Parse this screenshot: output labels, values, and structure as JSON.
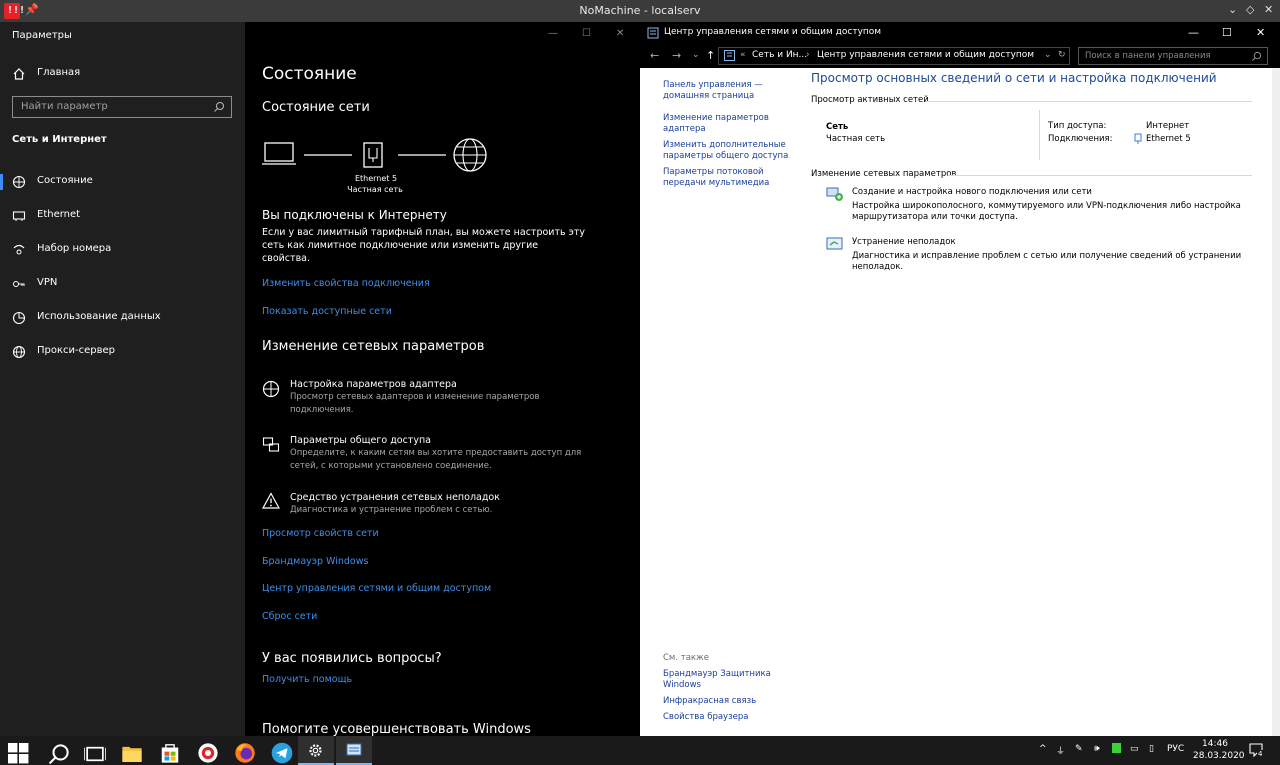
{
  "nomachine": {
    "title": "NoMachine - localserv"
  },
  "settings": {
    "window_title": "Параметры",
    "search_placeholder": "Найти параметр",
    "home": "Главная",
    "category": "Сеть и Интернет",
    "nav": [
      {
        "label": "Состояние",
        "icon": "globe-network-icon"
      },
      {
        "label": "Ethernet",
        "icon": "ethernet-icon"
      },
      {
        "label": "Набор номера",
        "icon": "dialup-icon"
      },
      {
        "label": "VPN",
        "icon": "vpn-icon"
      },
      {
        "label": "Использование данных",
        "icon": "data-usage-icon"
      },
      {
        "label": "Прокси-сервер",
        "icon": "globe-icon"
      }
    ],
    "page_title": "Состояние",
    "network_status_heading": "Состояние сети",
    "adapter_name": "Ethernet 5",
    "network_type": "Частная сеть",
    "connected_heading": "Вы подключены к Интернету",
    "connected_text_1": "Если у вас лимитный тарифный план, вы можете настроить эту",
    "connected_text_2": "сеть как лимитное подключение или изменить другие",
    "connected_text_3": "свойства.",
    "link_change_props": "Изменить свойства подключения",
    "link_show_networks": "Показать доступные сети",
    "change_heading": "Изменение сетевых параметров",
    "options": [
      {
        "title": "Настройка параметров адаптера",
        "desc1": "Просмотр сетевых адаптеров и изменение параметров",
        "desc2": "подключения."
      },
      {
        "title": "Параметры общего доступа",
        "desc1": "Определите, к каким сетям вы хотите предоставить доступ для",
        "desc2": "сетей, с которыми установлено соединение."
      },
      {
        "title": "Средство устранения сетевых неполадок",
        "desc1": "Диагностика и устранение проблем с сетью.",
        "desc2": ""
      }
    ],
    "links": [
      "Просмотр свойств сети",
      "Брандмауэр Windows",
      "Центр управления сетями и общим доступом",
      "Сброс сети"
    ],
    "questions_heading": "У вас появились вопросы?",
    "get_help": "Получить помощь",
    "improve_heading": "Помогите усовершенствовать Windows"
  },
  "control_panel": {
    "window_title": "Центр управления сетями и общим доступом",
    "breadcrumb_1": "Сеть и Ин...",
    "breadcrumb_2": "Центр управления сетями и общим доступом",
    "search_placeholder": "Поиск в панели управления",
    "left_links": [
      [
        "Панель управления —",
        "домашняя страница"
      ],
      [
        "Изменение параметров",
        "адаптера"
      ],
      [
        "Изменить дополнительные",
        "параметры общего доступа"
      ],
      [
        "Параметры потоковой",
        "передачи мультимедиа"
      ]
    ],
    "see_also": "См. также",
    "see_also_links": [
      [
        "Брандмауэр Защитника",
        "Windows"
      ],
      [
        "Инфракрасная связь",
        ""
      ],
      [
        "Свойства браузера",
        ""
      ]
    ],
    "main_heading": "Просмотр основных сведений о сети и настройка подключений",
    "active_networks": "Просмотр активных сетей",
    "network_name": "Сеть",
    "network_type": "Частная сеть",
    "access_type_label": "Тип доступа:",
    "access_type_value": "Интернет",
    "connections_label": "Подключения:",
    "connections_value": "Ethernet 5",
    "change_settings": "Изменение сетевых параметров",
    "tasks": [
      {
        "title": "Создание и настройка нового подключения или сети",
        "desc1": "Настройка широкополосного, коммутируемого или VPN-подключения либо настройка",
        "desc2": "маршрутизатора или точки доступа."
      },
      {
        "title": "Устранение неполадок",
        "desc1": "Диагностика и исправление проблем с сетью или получение сведений об устранении",
        "desc2": "неполадок."
      }
    ]
  },
  "taskbar": {
    "lang": "РУС",
    "time": "14:46",
    "date": "28.03.2020",
    "notif_count": "4"
  }
}
